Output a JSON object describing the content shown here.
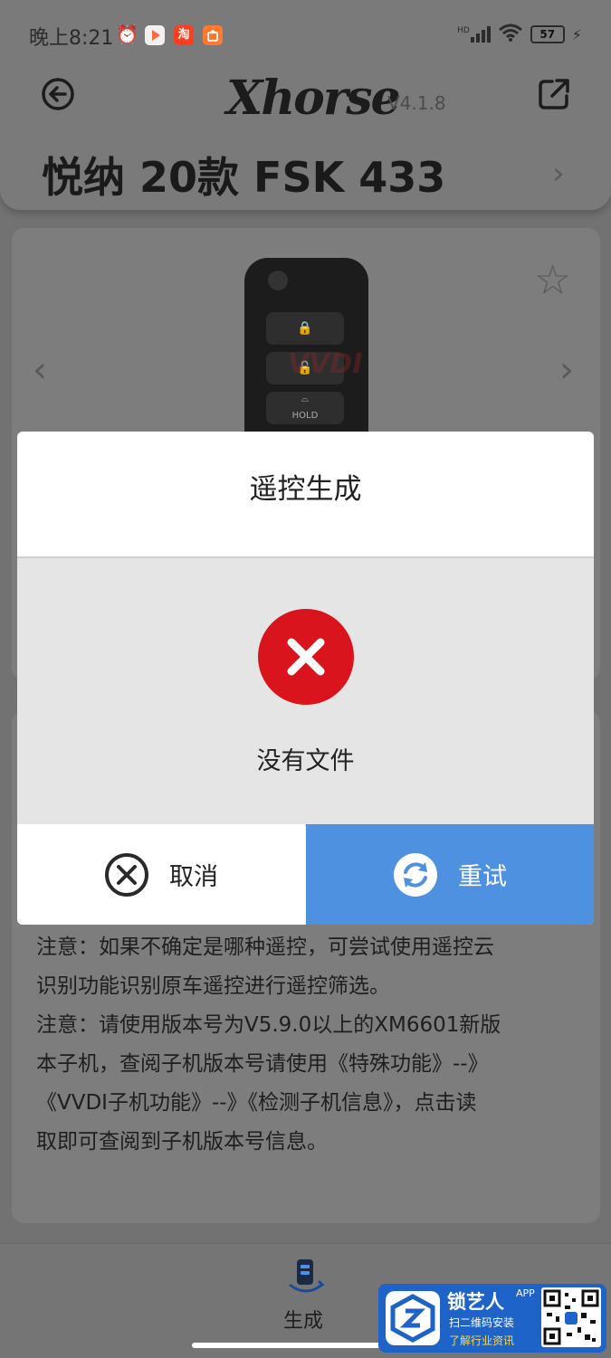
{
  "status_bar": {
    "time": "晚上8:21",
    "app_icons": [
      {
        "icon": "alarm-icon"
      },
      {
        "icon": "video-app-icon",
        "color": "#ff6a3d"
      },
      {
        "icon": "taobao-icon",
        "label": "淘",
        "color": "#ff3d1f"
      },
      {
        "icon": "shopping-bag-icon",
        "color": "#ff7a2f"
      }
    ],
    "network": "HD",
    "battery": "57",
    "battery_fraction": 0.57
  },
  "header": {
    "brand": "Xhorse",
    "version": "V4.1.8",
    "back_icon": "back-arrow-icon",
    "share_icon": "share-icon",
    "title": "悦纳 20款 FSK 433",
    "title_chevron": "›"
  },
  "product": {
    "favorite_icon": "star-icon",
    "prev_arrow": "‹",
    "next_arrow": "›",
    "key_button_hold_label": "HOLD",
    "watermark_text": "VVDI"
  },
  "notes": {
    "note1_line1": "注意：如果不确定是哪种遥控，可尝试使用遥控云",
    "note1_line2": "识别功能识别原车遥控进行遥控筛选。",
    "note2_line1": "注意：请使用版本号为V5.9.0以上的XM6601新版",
    "note2_line2": "本子机，查阅子机版本号请使用《特殊功能》--》",
    "note2_line3": "《VVDI子机功能》--》《检测子机信息》，点击读",
    "note2_line4": "取即可查阅到子机版本号信息。"
  },
  "bottom_nav": {
    "label": "生成",
    "icon": "generate-remote-icon"
  },
  "dialog": {
    "title": "遥控生成",
    "icon": "error-x-icon",
    "message": "没有文件",
    "cancel_label": "取消",
    "cancel_icon": "close-circle-icon",
    "retry_label": "重试",
    "retry_icon": "refresh-icon",
    "colors": {
      "error": "#d9141c",
      "retry_bg": "#4e91e0"
    }
  },
  "watermark_ad": {
    "title": "锁艺人",
    "badge": "APP",
    "line1": "扫二维码安装",
    "line2": "了解行业资讯"
  }
}
